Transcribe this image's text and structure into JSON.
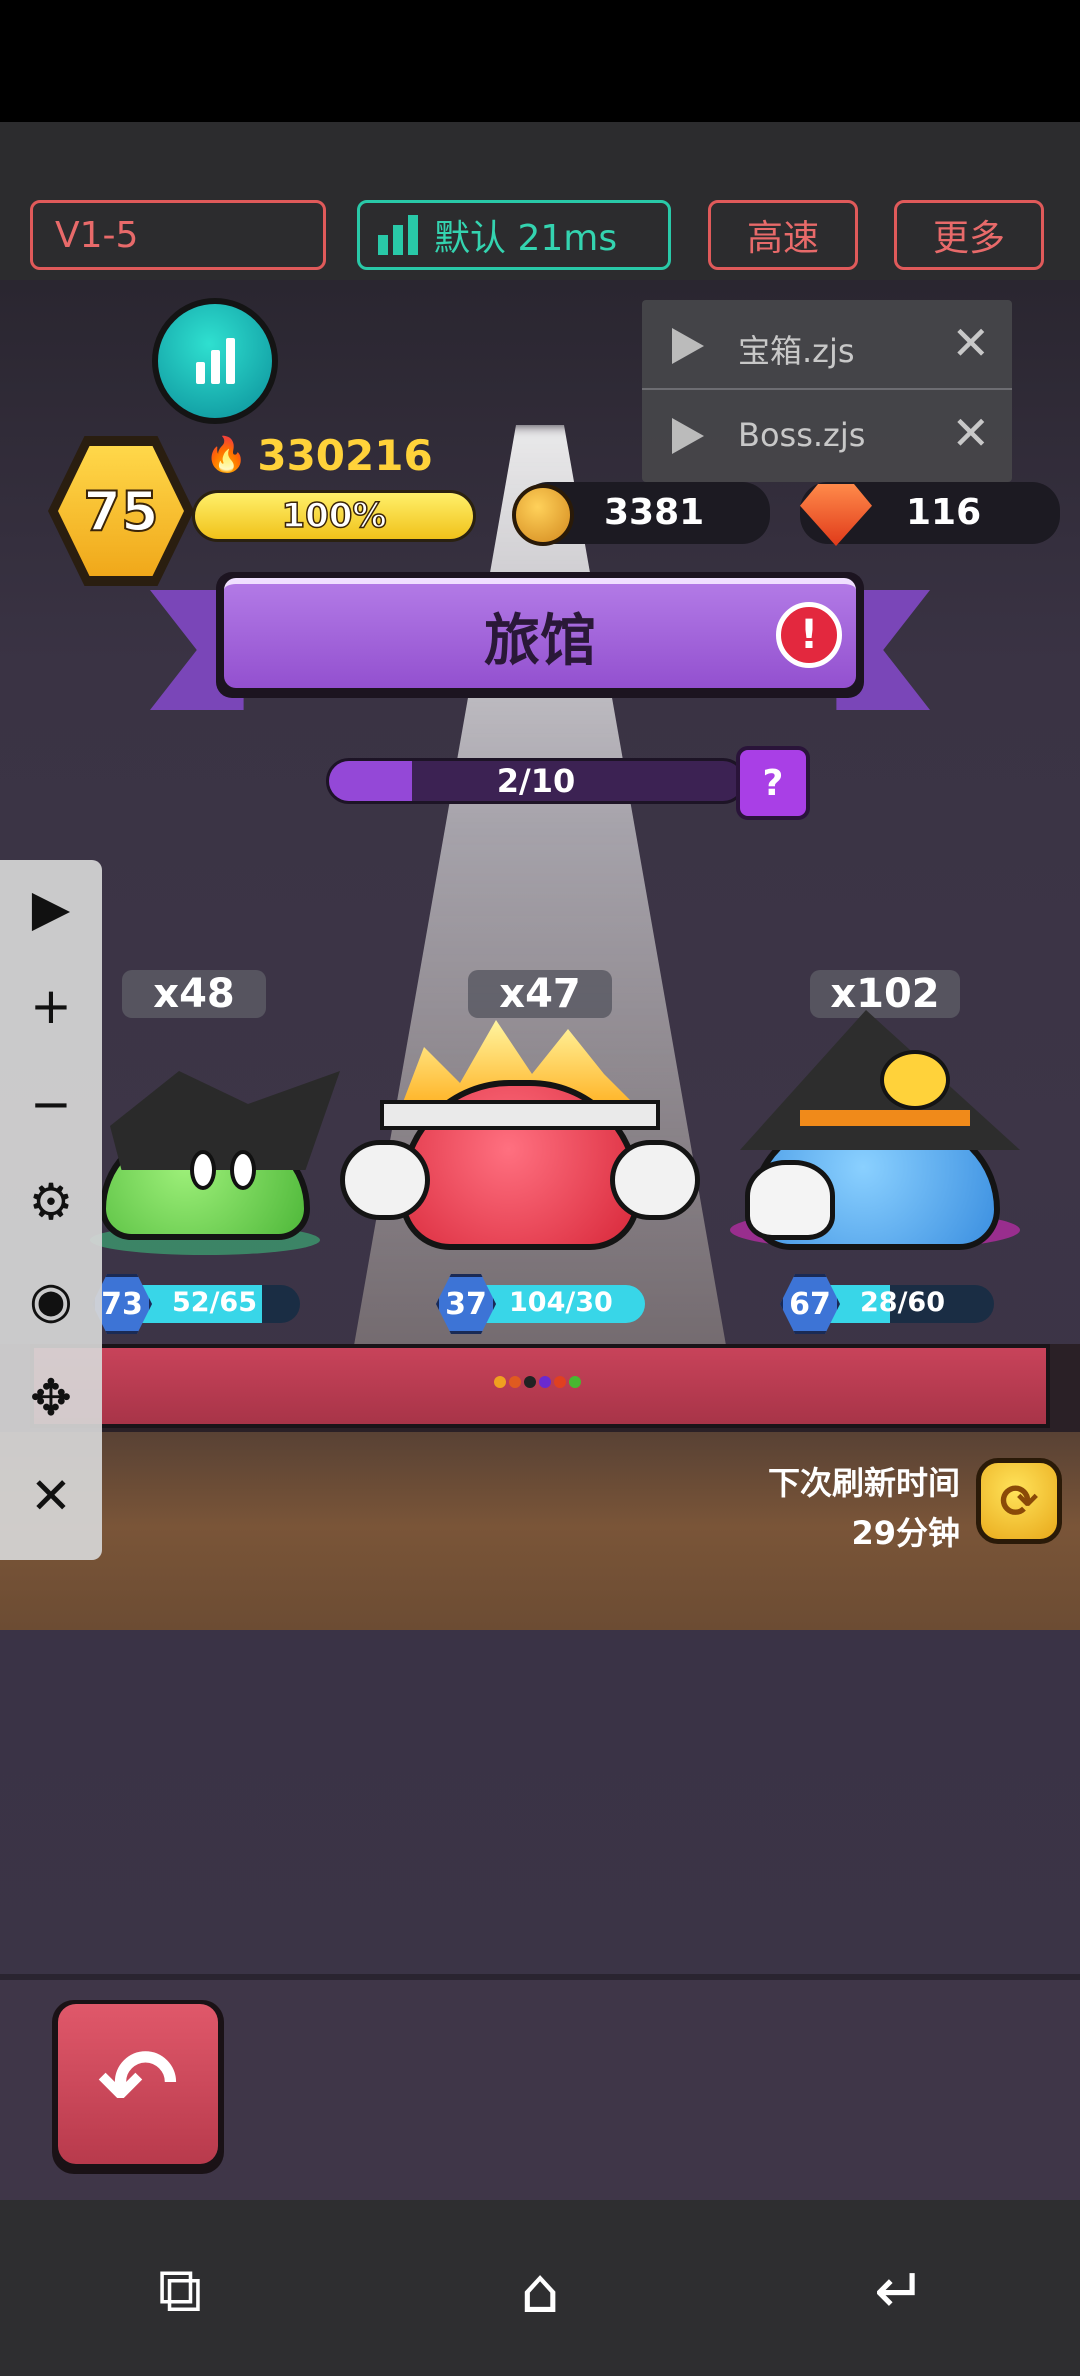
{
  "toolbar": {
    "level_label": "V1-5",
    "mode_label": "默认 21ms",
    "speed_label": "高速",
    "more_label": "更多"
  },
  "player": {
    "level": "75",
    "power": "330216",
    "xp_percent_text": "100%",
    "xp_fraction": 1.0,
    "coins": "3381",
    "gems": "116"
  },
  "scripts": [
    {
      "name": "宝箱.zjs"
    },
    {
      "name": "Boss.zjs"
    }
  ],
  "location": {
    "title": "旅馆",
    "progress_text": "2/10",
    "progress_fraction": 0.2,
    "help_label": "?"
  },
  "units": [
    {
      "count": "x48",
      "level": "73",
      "hp": "52/65",
      "hp_fraction": 0.8
    },
    {
      "count": "x47",
      "level": "37",
      "hp": "104/30",
      "hp_fraction": 1.0
    },
    {
      "count": "x102",
      "level": "67",
      "hp": "28/60",
      "hp_fraction": 0.47
    }
  ],
  "refresh": {
    "label": "下次刷新时间",
    "time": "29分钟"
  },
  "colors": {
    "accent_red": "#e05a5a",
    "accent_green": "#29c9a8",
    "banner_purple": "#9b55d6",
    "hp_cyan": "#38d6e8"
  }
}
